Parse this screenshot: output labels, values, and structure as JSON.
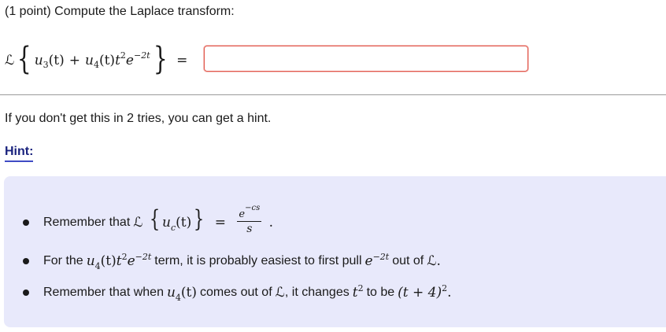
{
  "problem": {
    "title": "(1 point) Compute the Laplace transform:",
    "equation": {
      "operator": "ℒ",
      "term1_func": "u",
      "term1_sub": "3",
      "term1_arg": "(t)",
      "plus": "+",
      "term2_func": "u",
      "term2_sub": "4",
      "term2_arg": "(t)",
      "t": "t",
      "t_exp": "2",
      "e": "e",
      "e_exp": "−2t",
      "equals": "="
    },
    "answer": {
      "value": "",
      "placeholder": ""
    }
  },
  "tries_note": "If you don't get this in 2 tries, you can get a hint.",
  "hint": {
    "label": "Hint:",
    "items": [
      {
        "prefix": "Remember that",
        "operator": "ℒ",
        "func": "u",
        "func_sub": "c",
        "func_arg": "(t)",
        "equals": "=",
        "frac_num": "e",
        "frac_num_exp": "−cs",
        "frac_den": "s",
        "suffix": "."
      },
      {
        "prefix": "For the",
        "func": "u",
        "func_sub": "4",
        "func_arg": "(t)",
        "t": "t",
        "t_exp": "2",
        "e": "e",
        "e_exp": "−2t",
        "middle": "term, it is probably easiest to first pull",
        "pull_e": "e",
        "pull_e_exp": "−2t",
        "out_of": "out of",
        "operator": "ℒ",
        "suffix": "."
      },
      {
        "prefix": "Remember that when",
        "func": "u",
        "func_sub": "4",
        "func_arg": "(t)",
        "middle": "comes out of",
        "operator": "ℒ",
        "middle2": ", it changes",
        "t": "t",
        "t_exp": "2",
        "to_be": "to be",
        "replacement": "(t + 4)",
        "replacement_exp": "2",
        "suffix": "."
      }
    ]
  }
}
